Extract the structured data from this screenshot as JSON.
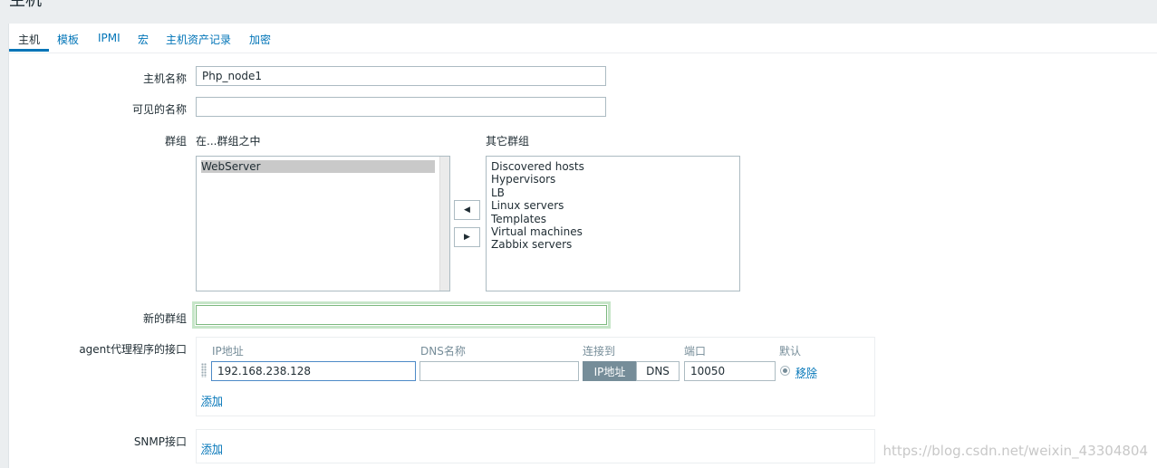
{
  "page": {
    "title": "主机"
  },
  "tabs": [
    {
      "label": "主机",
      "active": true
    },
    {
      "label": "模板",
      "active": false
    },
    {
      "label": "IPMI",
      "active": false
    },
    {
      "label": "宏",
      "active": false
    },
    {
      "label": "主机资产记录",
      "active": false
    },
    {
      "label": "加密",
      "active": false
    }
  ],
  "form": {
    "host_name_label": "主机名称",
    "host_name_value": "Php_node1",
    "visible_name_label": "可见的名称",
    "visible_name_value": "",
    "groups_label": "群组",
    "in_groups_label": "在...群组之中",
    "other_groups_label": "其它群组",
    "in_groups": [
      "WebServer"
    ],
    "other_groups": [
      "Discovered hosts",
      "Hypervisors",
      "LB",
      "Linux servers",
      "Templates",
      "Virtual machines",
      "Zabbix servers"
    ],
    "move_left_icon": "triangle-left-icon",
    "move_right_icon": "triangle-right-icon",
    "new_group_label": "新的群组",
    "new_group_value": ""
  },
  "agent_interfaces": {
    "label": "agent代理程序的接口",
    "headers": {
      "ip": "IP地址",
      "dns": "DNS名称",
      "connect": "连接到",
      "port": "端口",
      "default": "默认"
    },
    "row": {
      "ip": "192.168.238.128",
      "dns": "",
      "connect_ip": "IP地址",
      "connect_dns": "DNS",
      "port": "10050",
      "remove": "移除"
    },
    "add": "添加"
  },
  "snmp_interfaces": {
    "label": "SNMP接口",
    "add": "添加"
  },
  "watermark": "https://blog.csdn.net/weixin_43304804"
}
